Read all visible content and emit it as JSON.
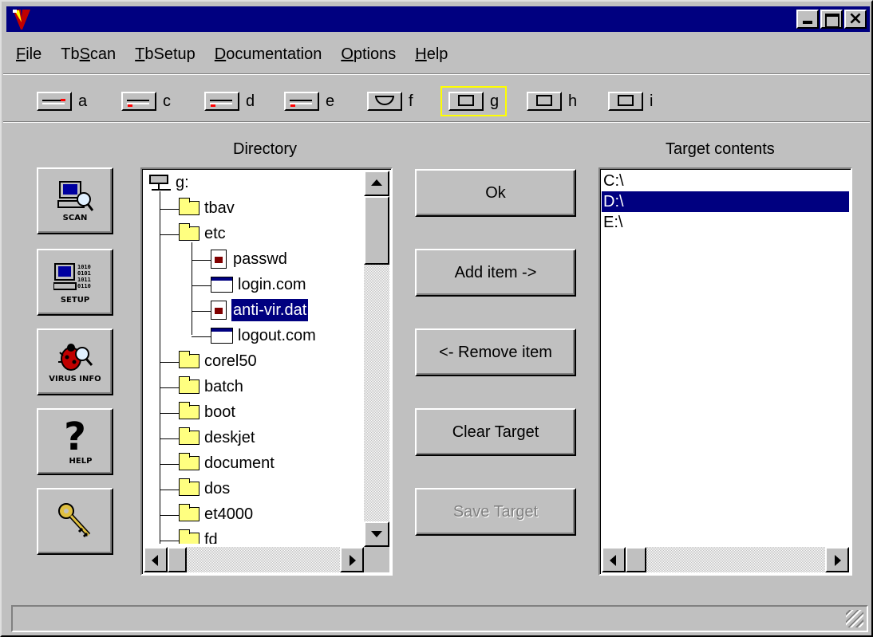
{
  "menu": [
    {
      "pre": "",
      "ul": "F",
      "post": "ile"
    },
    {
      "pre": "Tb",
      "ul": "S",
      "post": "can"
    },
    {
      "pre": "",
      "ul": "T",
      "post": "bSetup"
    },
    {
      "pre": "",
      "ul": "D",
      "post": "ocumentation"
    },
    {
      "pre": "",
      "ul": "O",
      "post": "ptions"
    },
    {
      "pre": "",
      "ul": "H",
      "post": "elp"
    }
  ],
  "drives": [
    {
      "letter": "a",
      "type": "floppy-icon"
    },
    {
      "letter": "c",
      "type": "hard-drive-icon"
    },
    {
      "letter": "d",
      "type": "hard-drive-icon"
    },
    {
      "letter": "e",
      "type": "hard-drive-icon"
    },
    {
      "letter": "f",
      "type": "cdrom-icon"
    },
    {
      "letter": "g",
      "type": "network-drive-icon",
      "selected": true
    },
    {
      "letter": "h",
      "type": "network-drive-icon"
    },
    {
      "letter": "i",
      "type": "network-drive-icon"
    }
  ],
  "labels": {
    "directory": "Directory",
    "target_contents": "Target contents"
  },
  "side_buttons": {
    "scan": "SCAN",
    "setup": "SETUP",
    "virus_info": "VIRUS INFO",
    "help": "HELP"
  },
  "tree": {
    "root": "g:",
    "items": [
      {
        "name": "tbav",
        "kind": "folder",
        "level": 1
      },
      {
        "name": "etc",
        "kind": "folder-open",
        "level": 1
      },
      {
        "name": "passwd",
        "kind": "file",
        "level": 2
      },
      {
        "name": "login.com",
        "kind": "exe",
        "level": 2
      },
      {
        "name": "anti-vir.dat",
        "kind": "file",
        "level": 2,
        "selected": true
      },
      {
        "name": "logout.com",
        "kind": "exe",
        "level": 2
      },
      {
        "name": "corel50",
        "kind": "folder",
        "level": 1
      },
      {
        "name": "batch",
        "kind": "folder",
        "level": 1
      },
      {
        "name": "boot",
        "kind": "folder",
        "level": 1
      },
      {
        "name": "deskjet",
        "kind": "folder",
        "level": 1
      },
      {
        "name": "document",
        "kind": "folder",
        "level": 1
      },
      {
        "name": "dos",
        "kind": "folder",
        "level": 1
      },
      {
        "name": "et4000",
        "kind": "folder",
        "level": 1
      },
      {
        "name": "fd",
        "kind": "folder",
        "level": 1
      }
    ]
  },
  "buttons": {
    "ok": "Ok",
    "add": "Add item ->",
    "remove": "<- Remove item",
    "clear": "Clear Target",
    "save": "Save Target"
  },
  "target": [
    {
      "path": "C:\\"
    },
    {
      "path": "D:\\",
      "selected": true
    },
    {
      "path": "E:\\"
    }
  ],
  "colors": {
    "titlebar": "#000080",
    "selection": "#000080",
    "face": "#c0c0c0"
  }
}
